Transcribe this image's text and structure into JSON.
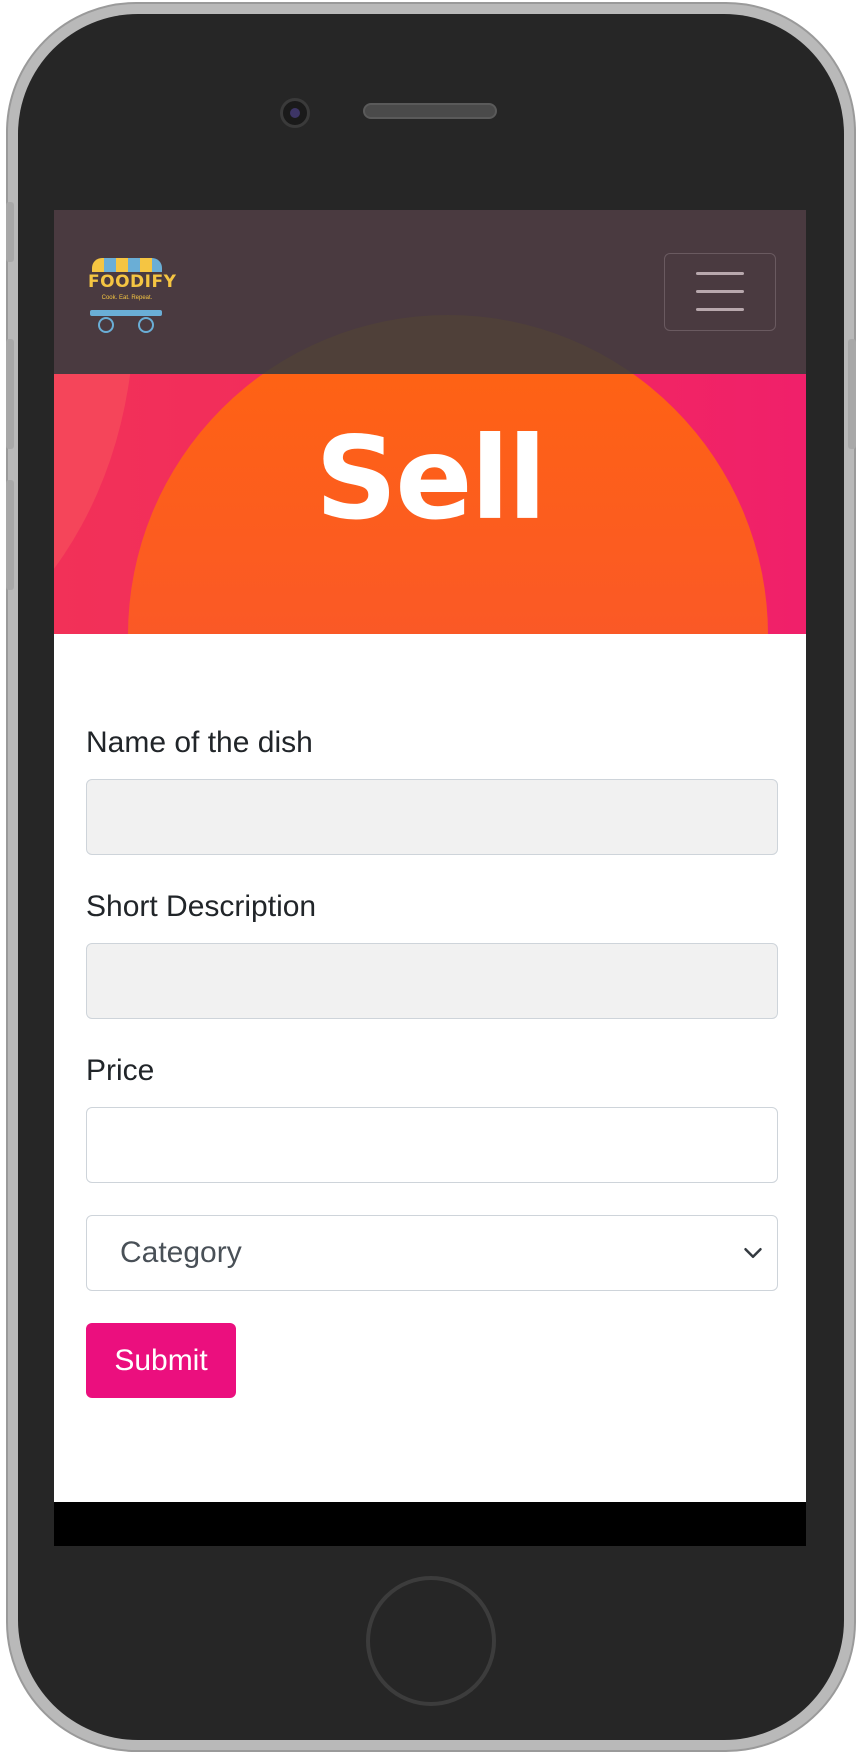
{
  "navbar": {
    "brand": "FOODIFY",
    "tagline": "Cook. Eat. Repeat.",
    "menu_icon": "hamburger-icon"
  },
  "hero": {
    "title": "Sell"
  },
  "form": {
    "dish_name_label": "Name of the dish",
    "dish_name_value": "",
    "description_label": "Short Description",
    "description_value": "",
    "price_label": "Price",
    "price_value": "",
    "category_selected": "Category",
    "submit_label": "Submit"
  },
  "colors": {
    "navbar_bg": "#4a3a40",
    "hero_bg": "#f2285f",
    "hero_circle": "#ff6410",
    "submit_bg": "#eb0f7e",
    "brand_yellow": "#f5c542",
    "brand_blue": "#6aaed6"
  }
}
